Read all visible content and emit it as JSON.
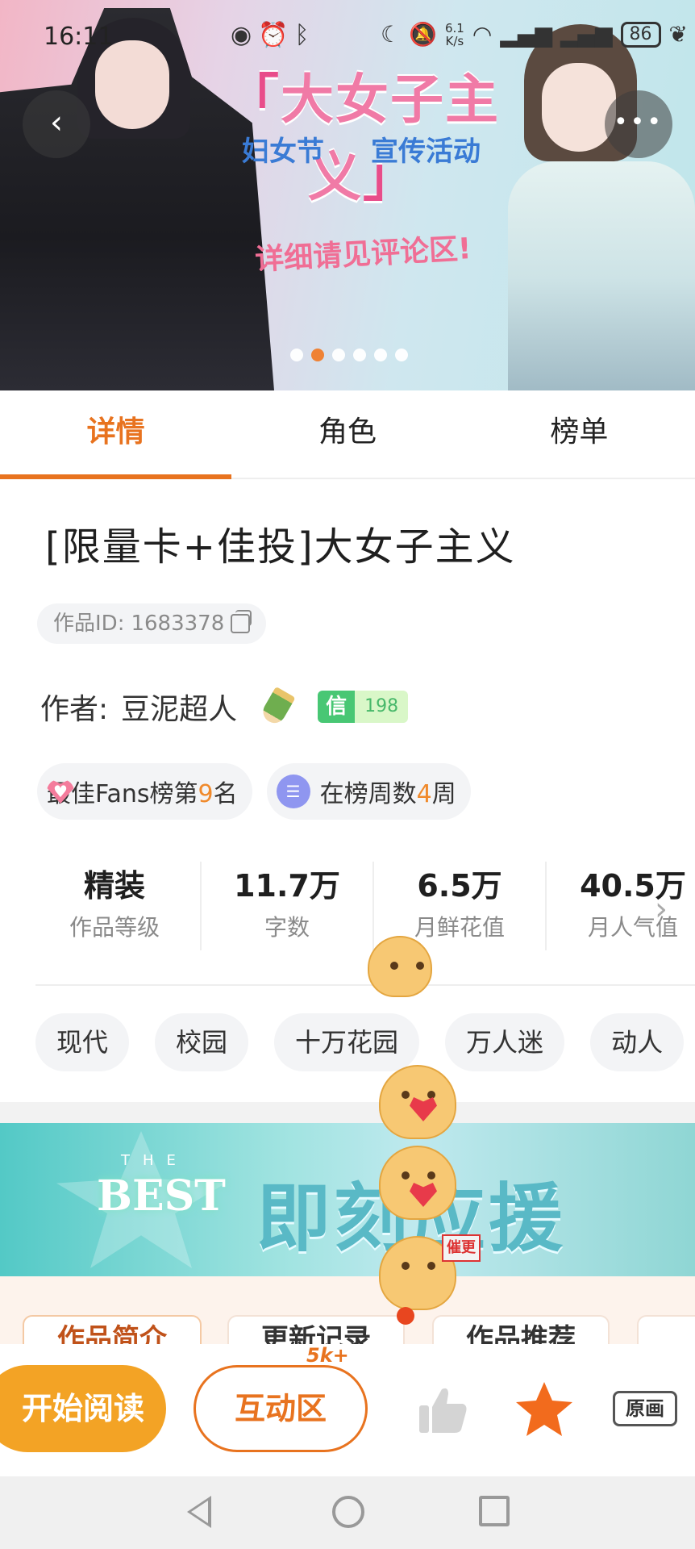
{
  "status_bar": {
    "time": "16:11",
    "net_speed_value": "6.1",
    "net_speed_unit": "K/s",
    "battery": "86"
  },
  "banner": {
    "title": "大女子主义",
    "subtitle_left": "妇女节",
    "subtitle_right": "宣传活动",
    "note": "详细请见评论区!",
    "slide_count": 6,
    "active_slide": 2
  },
  "tabs": [
    {
      "label": "详情",
      "active": true
    },
    {
      "label": "角色",
      "active": false
    },
    {
      "label": "榜单",
      "active": false
    }
  ],
  "work": {
    "title": "[限量卡+佳投]大女子主义",
    "id_label": "作品ID: ",
    "id_value": "1683378",
    "author_label": "作者: ",
    "author_name": "豆泥超人",
    "credit_label": "信",
    "credit_value": "198"
  },
  "rank_chips": [
    {
      "prefix": "最佳Fans榜第",
      "number": "9",
      "suffix": "名"
    },
    {
      "prefix": "在榜周数",
      "number": "4",
      "suffix": "周"
    }
  ],
  "stats": [
    {
      "value": "精装",
      "label": "作品等级"
    },
    {
      "value": "11.7万",
      "label": "字数"
    },
    {
      "value": "6.5万",
      "label": "月鲜花值"
    },
    {
      "value": "40.5万",
      "label": "月人气值"
    }
  ],
  "tags": [
    "现代",
    "校园",
    "十万花园",
    "万人迷",
    "动人"
  ],
  "promo": {
    "the": "THE",
    "best": "BEST",
    "cta": "即刻应援"
  },
  "sub_tabs": [
    "作品简介",
    "更新记录",
    "作品推荐"
  ],
  "action_bar": {
    "read_label": "开始阅读",
    "interact_label": "互动区",
    "interact_badge": "5k+",
    "original_label": "原画"
  },
  "sticker": {
    "sign_text": "催更"
  },
  "colors": {
    "accent": "#e8731f",
    "read_button": "#f3a325",
    "credit_green": "#48c774",
    "favorite": "#f26b1d"
  },
  "icons": {
    "back": "chevron-left-icon",
    "more": "more-horizontal-icon",
    "copy": "copy-icon",
    "pencil": "pencil-icon",
    "like": "thumbs-up-icon",
    "favorite": "star-icon"
  }
}
